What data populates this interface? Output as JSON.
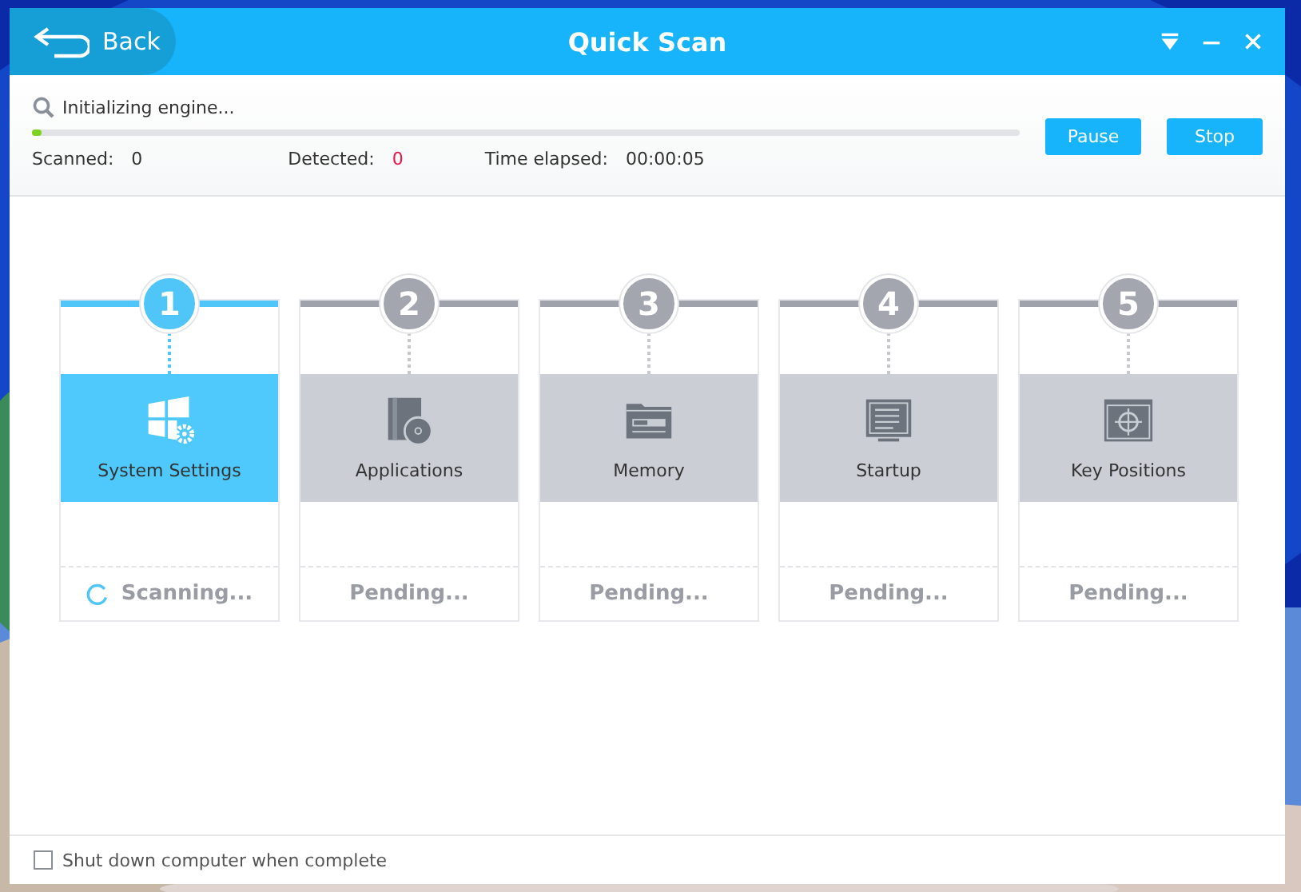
{
  "header": {
    "back": "Back",
    "title": "Quick Scan"
  },
  "status": {
    "message": "Initializing engine...",
    "level": 0.01,
    "scanned_label": "Scanned:",
    "scanned": "0",
    "detected_label": "Detected:",
    "detected": "0",
    "elapsed_label": "Time elapsed:",
    "elapsed": "00:00:05"
  },
  "buttons": [
    "Pause",
    "Stop"
  ],
  "steps": [
    {
      "number": "1",
      "label": "System Settings",
      "status": "Scanning...",
      "selected": true,
      "kind": "settings"
    },
    {
      "number": "2",
      "label": "Applications",
      "status": "Pending...",
      "selected": false,
      "kind": "applications"
    },
    {
      "number": "3",
      "label": "Memory",
      "status": "Pending...",
      "selected": false,
      "kind": "memory"
    },
    {
      "number": "4",
      "label": "Startup",
      "status": "Pending...",
      "selected": false,
      "kind": "startup"
    },
    {
      "number": "5",
      "label": "Key Positions",
      "status": "Pending...",
      "selected": false,
      "kind": "positions"
    }
  ],
  "shutdown": {
    "label": "Shut down computer when complete",
    "checked": false
  }
}
